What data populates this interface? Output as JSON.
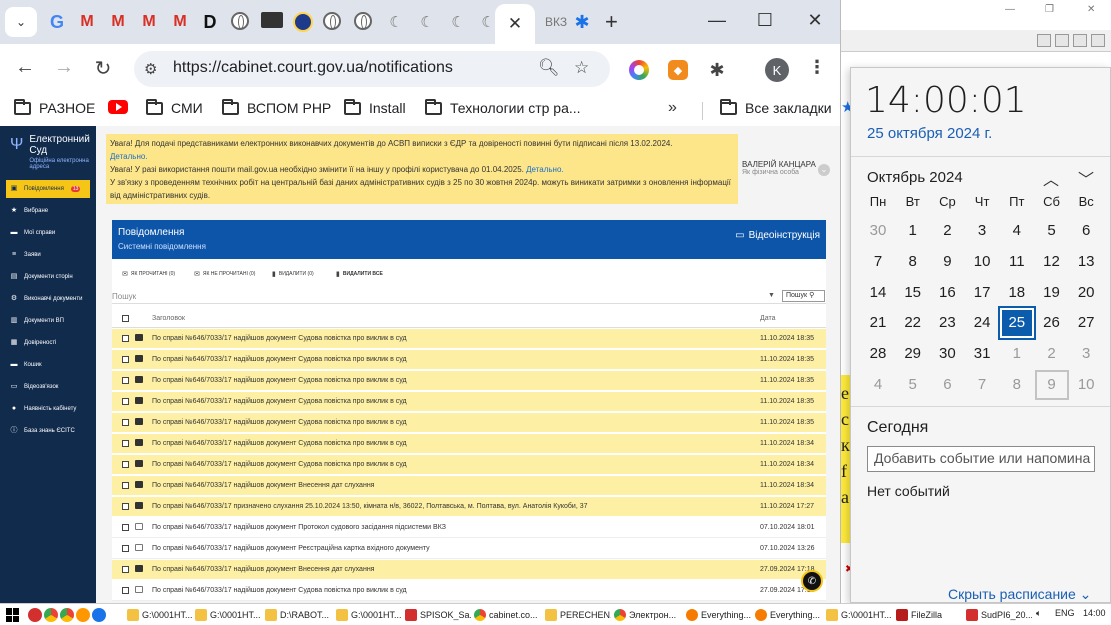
{
  "browser": {
    "tab_icons": [
      "google-icon",
      "gmail-icon",
      "gmail-icon",
      "gmail-icon",
      "gmail-icon",
      "d-icon",
      "globe-icon",
      "archive-icon",
      "mask-icon",
      "globe-icon",
      "globe-icon",
      "moon-icon",
      "moon-icon",
      "moon-icon",
      "moon-icon"
    ],
    "inactive_tab_text": "ВКЗ",
    "url": "https://cabinet.court.gov.ua/notifications",
    "avatar_letter": "K",
    "bookmarks": [
      {
        "label": "РАЗНОЕ",
        "icon": "folder-icon"
      },
      {
        "label": "",
        "icon": "youtube-icon"
      },
      {
        "label": "СМИ",
        "icon": "folder-icon"
      },
      {
        "label": "ВСПОМ PHP",
        "icon": "folder-icon"
      },
      {
        "label": "Install",
        "icon": "folder-icon"
      },
      {
        "label": "Технологии стр ра...",
        "icon": "folder-icon"
      }
    ],
    "all_bookmarks": "Все закладки"
  },
  "site": {
    "brand_line1": "Електронний",
    "brand_line2": "Суд",
    "brand_sub": "Офіційна електронна адреса",
    "sidebar": [
      {
        "label": "Повідомлення",
        "icon": "message-icon",
        "active": true,
        "badge": "13"
      },
      {
        "label": "Вибране",
        "icon": "star-icon"
      },
      {
        "label": "Мої справи",
        "icon": "folder-icon"
      },
      {
        "label": "Заяви",
        "icon": "list-icon"
      },
      {
        "label": "Документи сторін",
        "icon": "documents-icon"
      },
      {
        "label": "Виконавчі документи",
        "icon": "gear-icon"
      },
      {
        "label": "Документи ВП",
        "icon": "document-icon"
      },
      {
        "label": "Довіреності",
        "icon": "contract-icon"
      },
      {
        "label": "Кошик",
        "icon": "cart-icon"
      },
      {
        "label": "Відеозв'язок",
        "icon": "video-icon"
      },
      {
        "label": "Наявність кабінету",
        "icon": "person-icon"
      },
      {
        "label": "База знань ЄСІТС",
        "icon": "info-icon"
      }
    ],
    "notice": {
      "line1": "Увага! Для подачі представниками електронних виконавчих документів до АСВП виписки з ЄДР та довіреності повинні бути підписані після 13.02.2024.",
      "line1_link": "Детально.",
      "line2": "Увага! У разі використання пошти mail.gov.ua необхідно змінити її на іншу у профілі користувача до 01.04.2025.",
      "line2_link": "Детально.",
      "line3": "У зв'язку з проведенням технічних робіт на центральній базі даних адміністративних судів з 25 по 30 жовтня 2024р. можуть виникати затримки з оновлення інформації від адміністративних судів."
    },
    "user": {
      "name": "ВАЛЕРІЙ КАНЦАРА",
      "role": "Як фізична особа"
    },
    "panel": {
      "title": "Повідомлення",
      "subtitle": "Системні повідомлення",
      "video_label": "Відеоінструкція",
      "actions": [
        {
          "label": "ЯК ПРОЧИТАНІ (0)",
          "icon": "mail-open-icon"
        },
        {
          "label": "ЯК НЕ ПРОЧИТАНІ (0)",
          "icon": "mail-icon"
        },
        {
          "label": "ВИДАЛИТИ (0)",
          "icon": "trash-icon"
        },
        {
          "label": "ВИДАЛИТИ ВСЕ",
          "icon": "trash-icon"
        }
      ],
      "search_placeholder": "Пошук",
      "search_button": "Пошук",
      "col_subject": "Заголовок",
      "col_date": "Дата",
      "rows": [
        {
          "subject": "По справі №646/7033/17 надійшов документ Судова повістка про виклик в суд",
          "date": "11.10.2024 18:35",
          "unread": true
        },
        {
          "subject": "По справі №646/7033/17 надійшов документ Судова повістка про виклик в суд",
          "date": "11.10.2024 18:35",
          "unread": true
        },
        {
          "subject": "По справі №646/7033/17 надійшов документ Судова повістка про виклик в суд",
          "date": "11.10.2024 18:35",
          "unread": true
        },
        {
          "subject": "По справі №646/7033/17 надійшов документ Судова повістка про виклик в суд",
          "date": "11.10.2024 18:35",
          "unread": true
        },
        {
          "subject": "По справі №646/7033/17 надійшов документ Судова повістка про виклик в суд",
          "date": "11.10.2024 18:35",
          "unread": true
        },
        {
          "subject": "По справі №646/7033/17 надійшов документ Судова повістка про виклик в суд",
          "date": "11.10.2024 18:34",
          "unread": true
        },
        {
          "subject": "По справі №646/7033/17 надійшов документ Судова повістка про виклик в суд",
          "date": "11.10.2024 18:34",
          "unread": true
        },
        {
          "subject": "По справі №646/7033/17 надійшов документ Внесення дат слухання",
          "date": "11.10.2024 18:34",
          "unread": true
        },
        {
          "subject": "По справі №646/7033/17 призначено слухання 25.10.2024 13:50, кімната н/в, 36022, Полтавська, м. Полтава, вул. Анатолія Кукоби, 37",
          "date": "11.10.2024 17:27",
          "unread": true
        },
        {
          "subject": "По справі №646/7033/17 надійшов документ Протокол судового засідання підсистеми ВКЗ",
          "date": "07.10.2024 18:01",
          "unread": false
        },
        {
          "subject": "По справі №646/7033/17 надійшов документ Реєстраційна картка вхідного документу",
          "date": "07.10.2024 13:26",
          "unread": false
        },
        {
          "subject": "По справі №646/7033/17 надійшов документ Внесення дат слухання",
          "date": "27.09.2024 17:18",
          "unread": true
        },
        {
          "subject": "По справі №646/7033/17 надійшов документ Судова повістка про виклик в суд",
          "date": "27.09.2024 17:18",
          "unread": false
        }
      ]
    }
  },
  "calendar": {
    "time": "14:00:01",
    "date": "25 октября 2024 г.",
    "month": "Октябрь 2024",
    "weekdays": [
      "Пн",
      "Вт",
      "Ср",
      "Чт",
      "Пт",
      "Сб",
      "Вс"
    ],
    "weeks": [
      [
        "30",
        "1",
        "2",
        "3",
        "4",
        "5",
        "6"
      ],
      [
        "7",
        "8",
        "9",
        "10",
        "11",
        "12",
        "13"
      ],
      [
        "14",
        "15",
        "16",
        "17",
        "18",
        "19",
        "20"
      ],
      [
        "21",
        "22",
        "23",
        "24",
        "25",
        "26",
        "27"
      ],
      [
        "28",
        "29",
        "30",
        "31",
        "1",
        "2",
        "3"
      ],
      [
        "4",
        "5",
        "6",
        "7",
        "8",
        "9",
        "10"
      ]
    ],
    "today_label": "Сегодня",
    "event_placeholder": "Добавить событие или напомина",
    "no_events": "Нет событий",
    "hide_schedule": "Скрыть расписание"
  },
  "background_window": {
    "glyphs": [
      "е",
      "с",
      "к",
      "f",
      "а"
    ]
  },
  "taskbar": {
    "items": [
      {
        "label": "G:\\0001НТ...",
        "icon": "folder-icon"
      },
      {
        "label": "G:\\0001НТ...",
        "icon": "folder-icon"
      },
      {
        "label": "D:\\RABOT...",
        "icon": "folder-icon"
      },
      {
        "label": "G:\\0001НТ...",
        "icon": "folder-icon"
      },
      {
        "label": "SPISOK_Sa...",
        "icon": "app-icon"
      },
      {
        "label": "cabinet.co...",
        "icon": "chrome-icon"
      },
      {
        "label": "PERECHEN...",
        "icon": "folder-icon"
      },
      {
        "label": "Электрон...",
        "icon": "chrome-icon"
      },
      {
        "label": "Everything...",
        "icon": "search-icon"
      },
      {
        "label": "Everything...",
        "icon": "search-icon"
      },
      {
        "label": "G:\\0001НТ...",
        "icon": "folder-icon"
      },
      {
        "label": "FileZilla",
        "icon": "filezilla-icon"
      },
      {
        "label": "SudPI6_20...",
        "icon": "app-icon"
      }
    ],
    "lang": "ENG",
    "time": "14:00"
  },
  "colors": {
    "sidebar": "#112b4d",
    "accent_yellow": "#f5c518",
    "panel_head": "#0d55a8",
    "unread_row": "#fdf0a4",
    "today": "#0b5cad"
  }
}
